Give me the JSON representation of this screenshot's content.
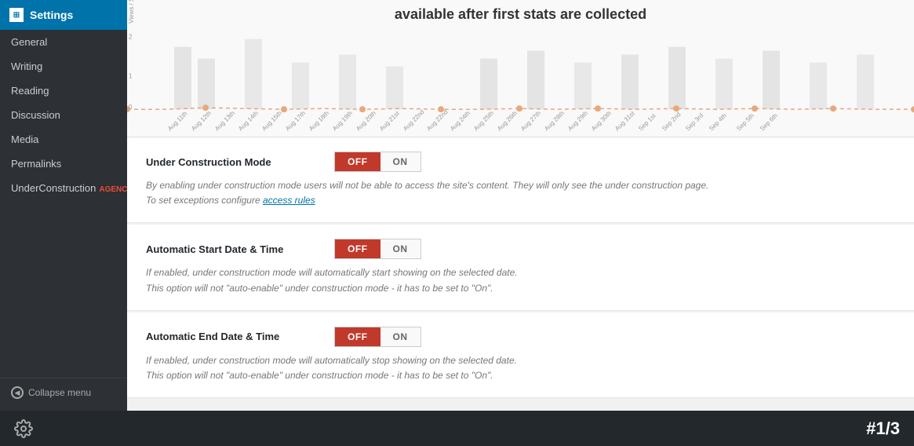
{
  "sidebar": {
    "title": "Settings",
    "items": [
      {
        "id": "general",
        "label": "General",
        "active": false
      },
      {
        "id": "writing",
        "label": "Writing",
        "active": false
      },
      {
        "id": "reading",
        "label": "Reading",
        "active": false
      },
      {
        "id": "discussion",
        "label": "Discussion",
        "active": false
      },
      {
        "id": "media",
        "label": "Media",
        "active": false
      },
      {
        "id": "permalinks",
        "label": "Permalinks",
        "active": false
      },
      {
        "id": "underconstruction",
        "label": "UnderConstruction",
        "badge": "AGENCY",
        "active": true
      }
    ],
    "collapse_label": "Collapse menu"
  },
  "chart": {
    "title": "available after first stats are collected",
    "y_label": "Views / S"
  },
  "settings": [
    {
      "id": "under_construction_mode",
      "label": "Under Construction Mode",
      "toggle_off": "OFF",
      "toggle_on": "ON",
      "state": "off",
      "description": "By enabling under construction mode users will not be able to access the site's content. They will only see the under construction page.",
      "description2": "To set exceptions configure",
      "link_text": "access rules",
      "link_href": "#"
    },
    {
      "id": "automatic_start",
      "label": "Automatic Start Date & Time",
      "toggle_off": "OFF",
      "toggle_on": "ON",
      "state": "off",
      "description": "If enabled, under construction mode will automatically start showing on the selected date.",
      "description2": "This option will not \"auto-enable\" under construction mode - it has to be set to \"On\"."
    },
    {
      "id": "automatic_end",
      "label": "Automatic End Date & Time",
      "toggle_off": "OFF",
      "toggle_on": "ON",
      "state": "off",
      "description": "If enabled, under construction mode will automatically stop showing on the selected date.",
      "description2": "This option will not \"auto-enable\" under construction mode - it has to be set to \"On\"."
    }
  ],
  "footer": {
    "page_number": "#1/3"
  },
  "colors": {
    "sidebar_bg": "#2d3035",
    "header_bg": "#0073aa",
    "active_bg": "#23282d",
    "toggle_off_active": "#c0392b",
    "toggle_on_active": "#27ae60"
  }
}
